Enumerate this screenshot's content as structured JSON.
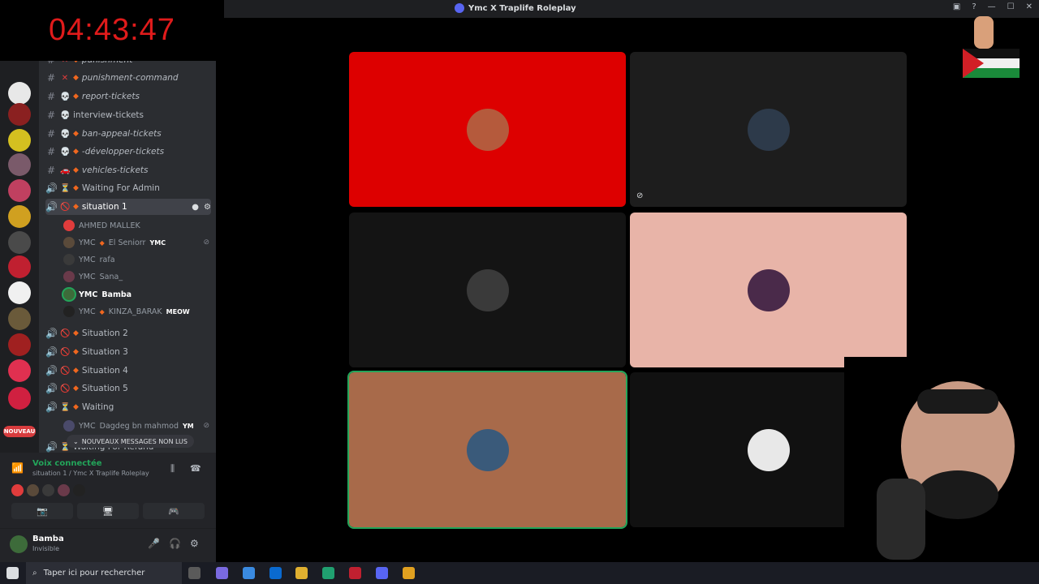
{
  "timer": "04:43:47",
  "window": {
    "title": "Ymc X Traplife Roleplay",
    "controls": [
      "▣",
      "?",
      "—",
      "☐",
      "✕"
    ]
  },
  "channels": [
    {
      "icon": "#",
      "emoji": "✕",
      "name": "punishment",
      "italic": true,
      "dim": true
    },
    {
      "icon": "#",
      "emoji": "✕",
      "name": "punishment-command",
      "italic": true
    },
    {
      "icon": "#",
      "emoji": "💀",
      "name": "report-tickets",
      "italic": true
    },
    {
      "icon": "#",
      "emoji": "💀",
      "name": "interview-tickets",
      "italic": false
    },
    {
      "icon": "#",
      "emoji": "💀",
      "name": "ban-appeal-tickets",
      "italic": true
    },
    {
      "icon": "#",
      "emoji": "💀",
      "name": "-développer-tickets",
      "italic": true
    },
    {
      "icon": "#",
      "emoji": "🚗",
      "name": "vehicles-tickets",
      "italic": true
    },
    {
      "icon": "🔊",
      "emoji": "⏳",
      "name": "Waiting For Admin",
      "italic": false
    }
  ],
  "selected_channel": {
    "icon": "🔊",
    "emoji": "🚫",
    "name": "situation 1"
  },
  "voice_users": [
    {
      "prefix": "",
      "name": "AHMED MALLEK",
      "tag": "",
      "color": "#e03c3c",
      "muted": false
    },
    {
      "prefix": "YMC",
      "name": "El Seniorr",
      "tag": "YMC",
      "color": "#5a4a3a",
      "muted": true
    },
    {
      "prefix": "YMC",
      "name": "rafa",
      "tag": "",
      "color": "#3a3a3a",
      "muted": false
    },
    {
      "prefix": "YMC",
      "name": "Sana_",
      "tag": "",
      "color": "#6a3a4a",
      "muted": false
    },
    {
      "prefix": "YMC",
      "name": "Bamba",
      "tag": "",
      "color": "#3d6b3a",
      "muted": false,
      "bold": true
    },
    {
      "prefix": "YMC",
      "name": "KINZA_BARAK",
      "tag": "MEOW",
      "color": "#222",
      "muted": false
    }
  ],
  "situations": [
    {
      "icon": "🔊",
      "emoji": "🚫",
      "name": "Situation 2"
    },
    {
      "icon": "🔊",
      "emoji": "🚫",
      "name": "Situation 3"
    },
    {
      "icon": "🔊",
      "emoji": "🚫",
      "name": "Situation 4"
    },
    {
      "icon": "🔊",
      "emoji": "🚫",
      "name": "Situation 5"
    },
    {
      "icon": "🔊",
      "emoji": "⏳",
      "name": "Waiting"
    }
  ],
  "waiting_user": {
    "prefix": "YMC",
    "name": "Dagdeg bn mahmod",
    "tag": "YM"
  },
  "partial_channel": "Waiting For Refund",
  "new_messages_pill": "NOUVEAUX MESSAGES NON LUS",
  "nouveau_badge": "NOUVEAU",
  "voice_panel": {
    "status": "Voix connectée",
    "server": "situation 1 / Ymc X Traplife Roleplay"
  },
  "account": {
    "name": "Bamba",
    "status": "Invisible"
  },
  "taskbar": {
    "search_placeholder": "Taper ici pour rechercher"
  },
  "tiles": [
    {
      "bg": "#dd0000",
      "avatar": "#b55a3c",
      "muted": false
    },
    {
      "bg": "#1d1d1d",
      "avatar": "#2d3a4a",
      "muted": true
    },
    {
      "bg": "#141414",
      "avatar": "#3a3a3a",
      "muted": false
    },
    {
      "bg": "#e8b4a8",
      "avatar": "#4a2a4a",
      "muted": false
    },
    {
      "bg": "#a86a4a",
      "avatar": "#3a5a7a",
      "muted": false,
      "speaking": true
    },
    {
      "bg": "#111111",
      "avatar": "#e8e8e8",
      "muted": false
    }
  ]
}
